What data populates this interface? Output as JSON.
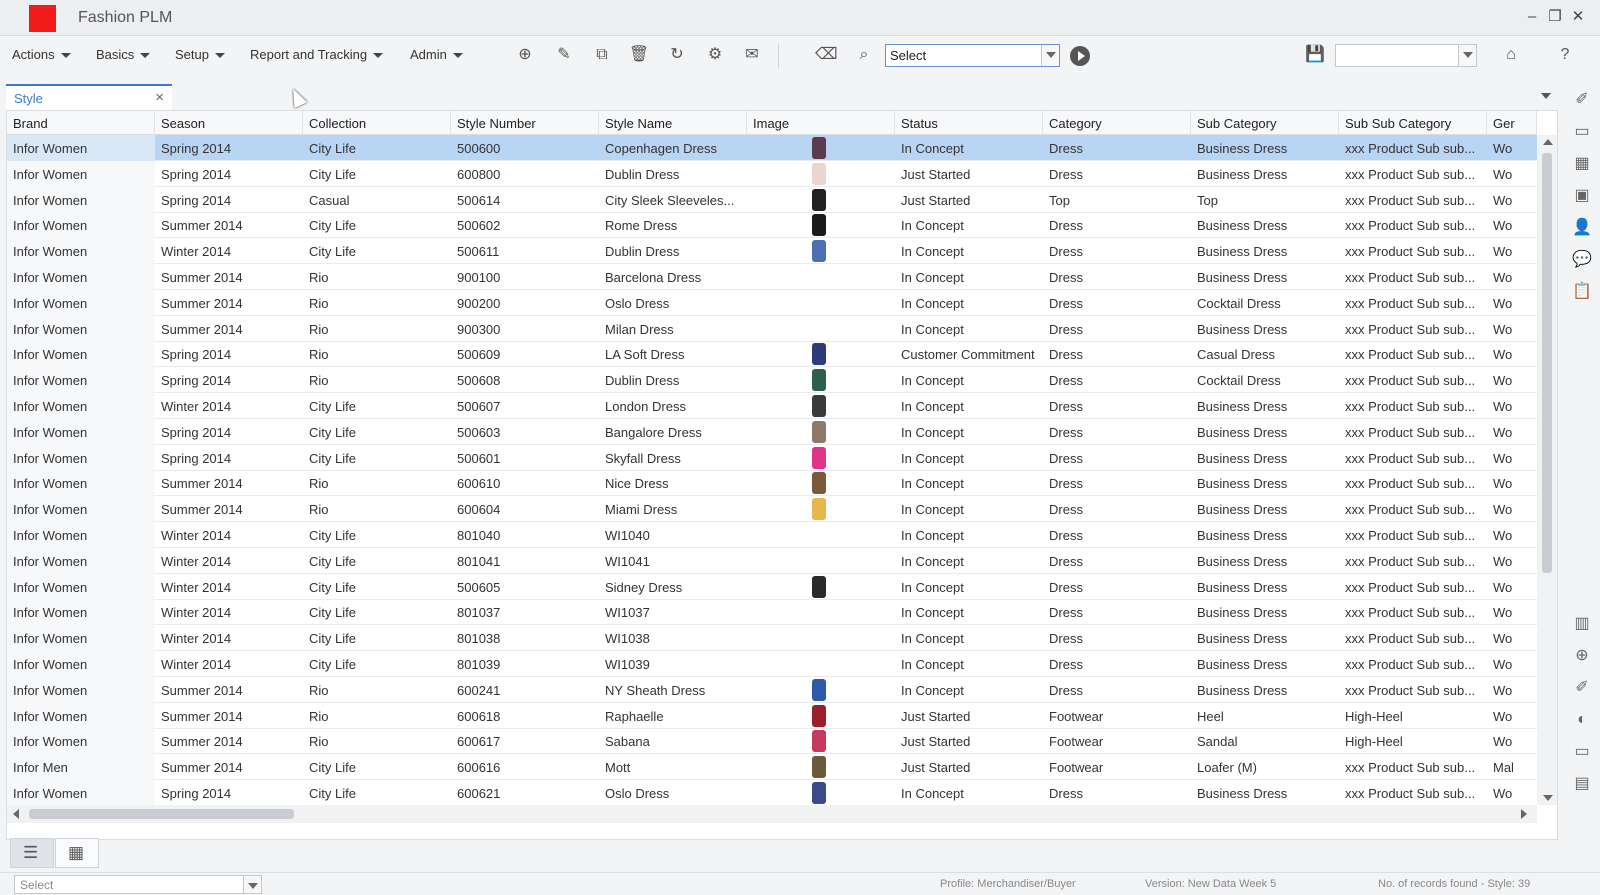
{
  "app": {
    "title": "Fashion PLM"
  },
  "menu": {
    "items": [
      {
        "label": "Actions"
      },
      {
        "label": "Basics"
      },
      {
        "label": "Setup"
      },
      {
        "label": "Report and Tracking"
      },
      {
        "label": "Admin"
      }
    ]
  },
  "toolbar": {
    "select_value": "Select",
    "icons": [
      "new-document-icon",
      "edit-icon",
      "copy-icon",
      "delete-icon",
      "refresh-icon",
      "group-icon",
      "mail-icon",
      "eraser-icon",
      "search-icon",
      "play-icon",
      "save-icon",
      "home-icon",
      "help-icon"
    ]
  },
  "tabs": [
    {
      "label": "Style",
      "close": "×"
    }
  ],
  "grid": {
    "columns": [
      "Brand",
      "Season",
      "Collection",
      "Style Number",
      "Style Name",
      "Image",
      "Status",
      "Category",
      "Sub Category",
      "Sub Sub Category",
      "Ger"
    ],
    "rows": [
      {
        "brand": "Infor Women",
        "season": "Spring 2014",
        "collection": "City Life",
        "style_number": "500600",
        "style_name": "Copenhagen Dress",
        "has_image": true,
        "thumb_color": "#5a3b4f",
        "status": "In Concept",
        "category": "Dress",
        "sub_category": "Business Dress",
        "sub_sub_category": "xxx Product Sub sub...",
        "gender": "Wo",
        "selected": true
      },
      {
        "brand": "Infor Women",
        "season": "Spring 2014",
        "collection": "City Life",
        "style_number": "600800",
        "style_name": "Dublin Dress",
        "has_image": true,
        "thumb_color": "#e8d6cf",
        "status": "Just Started",
        "category": "Dress",
        "sub_category": "Business Dress",
        "sub_sub_category": "xxx Product Sub sub...",
        "gender": "Wo"
      },
      {
        "brand": "Infor Women",
        "season": "Spring 2014",
        "collection": "Casual",
        "style_number": "500614",
        "style_name": "City Sleek Sleeveles...",
        "has_image": true,
        "thumb_color": "#222222",
        "status": "Just Started",
        "category": "Top",
        "sub_category": "Top",
        "sub_sub_category": "xxx Product Sub sub...",
        "gender": "Wo"
      },
      {
        "brand": "Infor Women",
        "season": "Summer 2014",
        "collection": "City Life",
        "style_number": "500602",
        "style_name": "Rome Dress",
        "has_image": true,
        "thumb_color": "#1a1a1a",
        "status": "In Concept",
        "category": "Dress",
        "sub_category": "Business Dress",
        "sub_sub_category": "xxx Product Sub sub...",
        "gender": "Wo"
      },
      {
        "brand": "Infor Women",
        "season": "Winter 2014",
        "collection": "City Life",
        "style_number": "500611",
        "style_name": "Dublin Dress",
        "has_image": true,
        "thumb_color": "#4a6fb3",
        "status": "In Concept",
        "category": "Dress",
        "sub_category": "Business Dress",
        "sub_sub_category": "xxx Product Sub sub...",
        "gender": "Wo"
      },
      {
        "brand": "Infor Women",
        "season": "Summer 2014",
        "collection": "Rio",
        "style_number": "900100",
        "style_name": "Barcelona Dress",
        "has_image": false,
        "status": "In Concept",
        "category": "Dress",
        "sub_category": "Business Dress",
        "sub_sub_category": "xxx Product Sub sub...",
        "gender": "Wo"
      },
      {
        "brand": "Infor Women",
        "season": "Summer 2014",
        "collection": "Rio",
        "style_number": "900200",
        "style_name": "Oslo Dress",
        "has_image": false,
        "status": "In Concept",
        "category": "Dress",
        "sub_category": "Cocktail Dress",
        "sub_sub_category": "xxx Product Sub sub...",
        "gender": "Wo"
      },
      {
        "brand": "Infor Women",
        "season": "Summer 2014",
        "collection": "Rio",
        "style_number": "900300",
        "style_name": "Milan Dress",
        "has_image": false,
        "status": "In Concept",
        "category": "Dress",
        "sub_category": "Business Dress",
        "sub_sub_category": "xxx Product Sub sub...",
        "gender": "Wo"
      },
      {
        "brand": "Infor Women",
        "season": "Spring 2014",
        "collection": "Rio",
        "style_number": "500609",
        "style_name": "LA Soft Dress",
        "has_image": true,
        "thumb_color": "#2d3b7a",
        "status": "Customer Commitment",
        "category": "Dress",
        "sub_category": "Casual Dress",
        "sub_sub_category": "xxx Product Sub sub...",
        "gender": "Wo"
      },
      {
        "brand": "Infor Women",
        "season": "Spring 2014",
        "collection": "Rio",
        "style_number": "500608",
        "style_name": "Dublin Dress",
        "has_image": true,
        "thumb_color": "#2f5e4a",
        "status": "In Concept",
        "category": "Dress",
        "sub_category": "Cocktail Dress",
        "sub_sub_category": "xxx Product Sub sub...",
        "gender": "Wo"
      },
      {
        "brand": "Infor Women",
        "season": "Winter 2014",
        "collection": "City Life",
        "style_number": "500607",
        "style_name": "London Dress",
        "has_image": true,
        "thumb_color": "#3a3a3a",
        "status": "In Concept",
        "category": "Dress",
        "sub_category": "Business Dress",
        "sub_sub_category": "xxx Product Sub sub...",
        "gender": "Wo"
      },
      {
        "brand": "Infor Women",
        "season": "Spring 2014",
        "collection": "City Life",
        "style_number": "500603",
        "style_name": "Bangalore Dress",
        "has_image": true,
        "thumb_color": "#8c7a6b",
        "status": "In Concept",
        "category": "Dress",
        "sub_category": "Business Dress",
        "sub_sub_category": "xxx Product Sub sub...",
        "gender": "Wo"
      },
      {
        "brand": "Infor Women",
        "season": "Spring 2014",
        "collection": "City Life",
        "style_number": "500601",
        "style_name": "Skyfall Dress",
        "has_image": true,
        "thumb_color": "#e0348a",
        "status": "In Concept",
        "category": "Dress",
        "sub_category": "Business Dress",
        "sub_sub_category": "xxx Product Sub sub...",
        "gender": "Wo"
      },
      {
        "brand": "Infor Women",
        "season": "Summer 2014",
        "collection": "Rio",
        "style_number": "600610",
        "style_name": "Nice Dress",
        "has_image": true,
        "thumb_color": "#7b5a3a",
        "status": "In Concept",
        "category": "Dress",
        "sub_category": "Business Dress",
        "sub_sub_category": "xxx Product Sub sub...",
        "gender": "Wo"
      },
      {
        "brand": "Infor Women",
        "season": "Summer 2014",
        "collection": "Rio",
        "style_number": "600604",
        "style_name": "Miami Dress",
        "has_image": true,
        "thumb_color": "#e6b84a",
        "status": "In Concept",
        "category": "Dress",
        "sub_category": "Business Dress",
        "sub_sub_category": "xxx Product Sub sub...",
        "gender": "Wo"
      },
      {
        "brand": "Infor Women",
        "season": "Winter 2014",
        "collection": "City Life",
        "style_number": "801040",
        "style_name": "WI1040",
        "has_image": false,
        "status": "In Concept",
        "category": "Dress",
        "sub_category": "Business Dress",
        "sub_sub_category": "xxx Product Sub sub...",
        "gender": "Wo"
      },
      {
        "brand": "Infor Women",
        "season": "Winter 2014",
        "collection": "City Life",
        "style_number": "801041",
        "style_name": "WI1041",
        "has_image": false,
        "status": "In Concept",
        "category": "Dress",
        "sub_category": "Business Dress",
        "sub_sub_category": "xxx Product Sub sub...",
        "gender": "Wo"
      },
      {
        "brand": "Infor Women",
        "season": "Winter 2014",
        "collection": "City Life",
        "style_number": "500605",
        "style_name": "Sidney Dress",
        "has_image": true,
        "thumb_color": "#2a2a2a",
        "status": "In Concept",
        "category": "Dress",
        "sub_category": "Business Dress",
        "sub_sub_category": "xxx Product Sub sub...",
        "gender": "Wo"
      },
      {
        "brand": "Infor Women",
        "season": "Winter 2014",
        "collection": "City Life",
        "style_number": "801037",
        "style_name": "WI1037",
        "has_image": false,
        "status": "In Concept",
        "category": "Dress",
        "sub_category": "Business Dress",
        "sub_sub_category": "xxx Product Sub sub...",
        "gender": "Wo"
      },
      {
        "brand": "Infor Women",
        "season": "Winter 2014",
        "collection": "City Life",
        "style_number": "801038",
        "style_name": "WI1038",
        "has_image": false,
        "status": "In Concept",
        "category": "Dress",
        "sub_category": "Business Dress",
        "sub_sub_category": "xxx Product Sub sub...",
        "gender": "Wo"
      },
      {
        "brand": "Infor Women",
        "season": "Winter 2014",
        "collection": "City Life",
        "style_number": "801039",
        "style_name": "WI1039",
        "has_image": false,
        "status": "In Concept",
        "category": "Dress",
        "sub_category": "Business Dress",
        "sub_sub_category": "xxx Product Sub sub...",
        "gender": "Wo"
      },
      {
        "brand": "Infor Women",
        "season": "Summer 2014",
        "collection": "Rio",
        "style_number": "600241",
        "style_name": "NY Sheath Dress",
        "has_image": true,
        "thumb_color": "#2c5aa8",
        "status": "In Concept",
        "category": "Dress",
        "sub_category": "Business Dress",
        "sub_sub_category": "xxx Product Sub sub...",
        "gender": "Wo"
      },
      {
        "brand": "Infor Women",
        "season": "Summer 2014",
        "collection": "Rio",
        "style_number": "600618",
        "style_name": "Raphaelle",
        "has_image": true,
        "thumb_color": "#9a1f2a",
        "status": "Just Started",
        "category": "Footwear",
        "sub_category": "Heel",
        "sub_sub_category": "High-Heel",
        "gender": "Wo"
      },
      {
        "brand": "Infor Women",
        "season": "Summer 2014",
        "collection": "Rio",
        "style_number": "600617",
        "style_name": "Sabana",
        "has_image": true,
        "thumb_color": "#c43a5c",
        "status": "Just Started",
        "category": "Footwear",
        "sub_category": "Sandal",
        "sub_sub_category": "High-Heel",
        "gender": "Wo"
      },
      {
        "brand": "Infor Men",
        "season": "Summer 2014",
        "collection": "City Life",
        "style_number": "600616",
        "style_name": "Mott",
        "has_image": true,
        "thumb_color": "#6a5a3a",
        "status": "Just Started",
        "category": "Footwear",
        "sub_category": "Loafer (M)",
        "sub_sub_category": "xxx Product Sub sub...",
        "gender": "Mal"
      },
      {
        "brand": "Infor Women",
        "season": "Spring 2014",
        "collection": "City Life",
        "style_number": "600621",
        "style_name": "Oslo Dress",
        "has_image": true,
        "thumb_color": "#3b4a8a",
        "status": "In Concept",
        "category": "Dress",
        "sub_category": "Business Dress",
        "sub_sub_category": "xxx Product Sub sub...",
        "gender": "Wo"
      }
    ]
  },
  "statusbar": {
    "select_value": "Select",
    "profile": "Profile: Merchandiser/Buyer",
    "version": "Version: New Data Week 5",
    "records": "No. of records found - Style: 39"
  },
  "colors": {
    "accent": "#3e7ad1",
    "selected_row": "#b8d5f3",
    "logo": "#f21b1b"
  }
}
